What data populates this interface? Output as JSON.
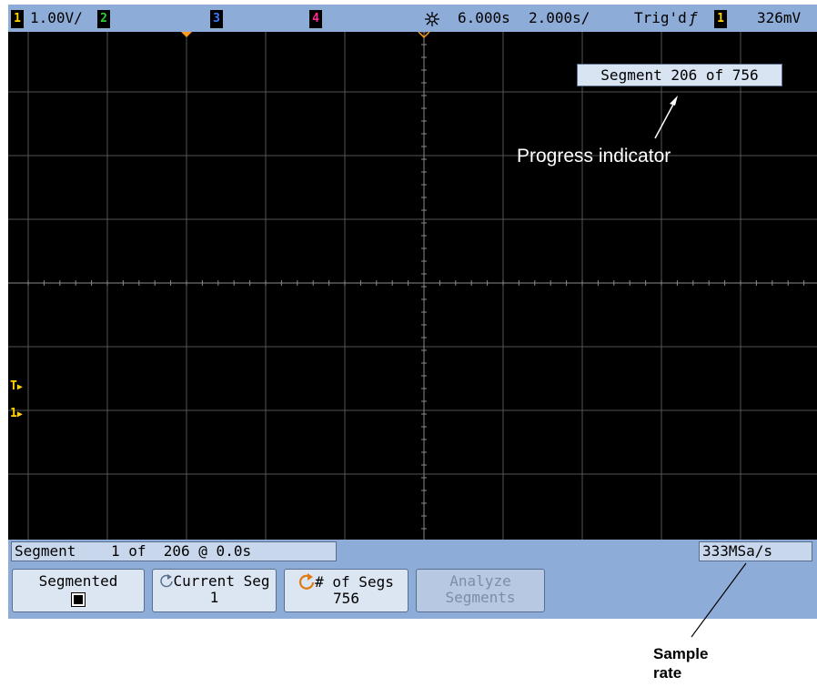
{
  "topbar": {
    "ch1_num": "1",
    "ch1_scale": "1.00V/",
    "ch2_num": "2",
    "ch3_num": "3",
    "ch4_num": "4",
    "time_delay": "6.000s",
    "time_scale": "2.000s/",
    "trigger_status": "Trig'd",
    "trigger_slope": "ƒ",
    "trigger_source": "1",
    "trigger_level": "326mV"
  },
  "overlay": {
    "segment_progress": "Segment 206 of 756",
    "progress_indicator_label": "Progress indicator"
  },
  "status": {
    "segment_info": "Segment    1 of  206 @ 0.0s",
    "sample_rate": "333MSa/s"
  },
  "softkeys": {
    "segmented_label": "Segmented",
    "current_seg_label": "Current Seg",
    "current_seg_value": "1",
    "num_segs_label": "# of Segs",
    "num_segs_value": "756",
    "analyze_line1": "Analyze",
    "analyze_line2": "Segments"
  },
  "annotations": {
    "sample_rate_line1": "Sample",
    "sample_rate_line2": "rate"
  },
  "markers": {
    "trigger_marker": "T",
    "ch1_ground_marker": "1"
  },
  "colors": {
    "ch1": "#ffd400",
    "ch2": "#29d32e",
    "ch3": "#3a7bff",
    "ch4": "#ff2a8f",
    "bar": "#8eacd8",
    "trigger_arrow": "#ff9a1f"
  },
  "icons": [
    "acquire-icon",
    "rotary-knob-icon",
    "rotary-knob-active-icon",
    "checkbox-icon"
  ]
}
